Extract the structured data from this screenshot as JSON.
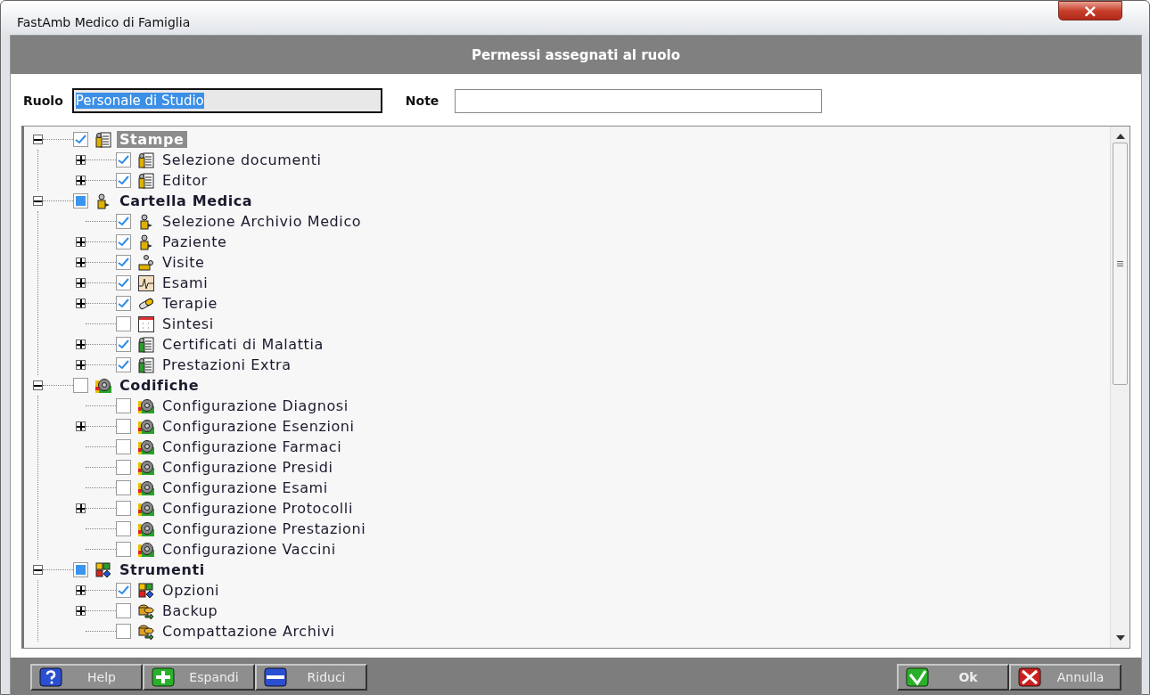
{
  "window": {
    "title": "FastAmb Medico di Famiglia",
    "close": "×"
  },
  "header": {
    "title": "Permessi assegnati al ruolo"
  },
  "form": {
    "role_label": "Ruolo",
    "role_value": "Personale di Studio",
    "note_label": "Note"
  },
  "tree": [
    {
      "label": "Stampe",
      "kind": "document",
      "checked": true,
      "expandable": true,
      "expanded": true,
      "selected": true,
      "children": [
        {
          "label": "Selezione documenti",
          "kind": "document",
          "checked": true,
          "expandable": true,
          "expanded": false,
          "selected": false
        },
        {
          "label": "Editor",
          "kind": "document",
          "checked": true,
          "expandable": true,
          "expanded": false,
          "selected": false
        }
      ]
    },
    {
      "label": "Cartella Medica",
      "kind": "doctor",
      "checked": false,
      "partial": true,
      "expandable": true,
      "expanded": true,
      "selected": false,
      "children": [
        {
          "label": "Selezione Archivio Medico",
          "kind": "doctor",
          "checked": true,
          "expandable": false,
          "selected": false
        },
        {
          "label": "Paziente",
          "kind": "doctor",
          "checked": true,
          "expandable": true,
          "expanded": false,
          "selected": false
        },
        {
          "label": "Visite",
          "kind": "visit",
          "checked": true,
          "expandable": true,
          "expanded": false,
          "selected": false
        },
        {
          "label": "Esami",
          "kind": "chart",
          "checked": true,
          "expandable": true,
          "expanded": false,
          "selected": false
        },
        {
          "label": "Terapie",
          "kind": "pill",
          "checked": true,
          "expandable": true,
          "expanded": false,
          "selected": false
        },
        {
          "label": "Sintesi",
          "kind": "calendar",
          "checked": false,
          "partial": false,
          "expandable": false,
          "selected": false
        },
        {
          "label": "Certificati di Malattia",
          "kind": "certificate",
          "checked": true,
          "expandable": true,
          "expanded": false,
          "selected": false
        },
        {
          "label": "Prestazioni Extra",
          "kind": "certificate",
          "checked": true,
          "expandable": true,
          "expanded": false,
          "selected": false
        }
      ]
    },
    {
      "label": "Codifiche",
      "kind": "gears",
      "checked": false,
      "partial": false,
      "expandable": true,
      "expanded": true,
      "selected": false,
      "children": [
        {
          "label": "Configurazione Diagnosi",
          "kind": "gears",
          "checked": false,
          "partial": false,
          "expandable": false,
          "selected": false
        },
        {
          "label": "Configurazione Esenzioni",
          "kind": "gears",
          "checked": false,
          "partial": false,
          "expandable": true,
          "expanded": false,
          "selected": false
        },
        {
          "label": "Configurazione Farmaci",
          "kind": "gears",
          "checked": false,
          "partial": false,
          "expandable": false,
          "selected": false
        },
        {
          "label": "Configurazione Presidi",
          "kind": "gears",
          "checked": false,
          "partial": false,
          "expandable": false,
          "selected": false
        },
        {
          "label": "Configurazione Esami",
          "kind": "gears",
          "checked": false,
          "partial": false,
          "expandable": false,
          "selected": false
        },
        {
          "label": "Configurazione Protocolli",
          "kind": "gears",
          "checked": false,
          "partial": false,
          "expandable": true,
          "expanded": false,
          "selected": false
        },
        {
          "label": "Configurazione Prestazioni",
          "kind": "gears",
          "checked": false,
          "partial": false,
          "expandable": false,
          "selected": false
        },
        {
          "label": "Configurazione Vaccini",
          "kind": "gears",
          "checked": false,
          "partial": false,
          "expandable": false,
          "selected": false
        }
      ]
    },
    {
      "label": "Strumenti",
      "kind": "blocks",
      "checked": false,
      "partial": true,
      "expandable": true,
      "expanded": true,
      "selected": false,
      "children": [
        {
          "label": "Opzioni",
          "kind": "blocks",
          "checked": true,
          "expandable": true,
          "expanded": false,
          "selected": false
        },
        {
          "label": "Backup",
          "kind": "database",
          "checked": false,
          "partial": false,
          "expandable": true,
          "expanded": false,
          "selected": false
        },
        {
          "label": "Compattazione Archivi",
          "kind": "database",
          "checked": false,
          "partial": false,
          "expandable": false,
          "selected": false
        }
      ]
    }
  ],
  "footer": {
    "left": [
      {
        "label": "Help",
        "kind": "help"
      },
      {
        "label": "Espandi",
        "kind": "plus"
      },
      {
        "label": "Riduci",
        "kind": "minus"
      }
    ],
    "right": [
      {
        "label": "Ok",
        "kind": "ok"
      },
      {
        "label": "Annulla",
        "kind": "cancel"
      }
    ]
  }
}
